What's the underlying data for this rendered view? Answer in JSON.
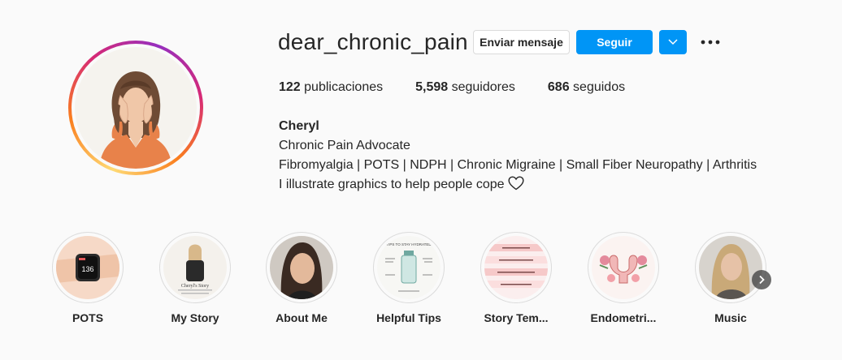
{
  "profile": {
    "username": "dear_chronic_pain",
    "buttons": {
      "message": "Enviar mensaje",
      "follow": "Seguir"
    },
    "stats": {
      "posts_count": "122",
      "posts_label": "publicaciones",
      "followers_count": "5,598",
      "followers_label": "seguidores",
      "following_count": "686",
      "following_label": "seguidos"
    },
    "bio": {
      "name": "Cheryl",
      "line1": "Chronic Pain Advocate",
      "line2": "Fibromyalgia | POTS | NDPH | Chronic Migraine | Small Fiber Neuropathy | Arthritis",
      "line3": "I illustrate graphics to help people cope"
    }
  },
  "highlights": [
    {
      "label": "POTS"
    },
    {
      "label": "My Story",
      "image_text": "Cheryl's Story"
    },
    {
      "label": "About Me"
    },
    {
      "label": "Helpful Tips",
      "image_text": "TIPS TO STAY HYDRATED"
    },
    {
      "label": "Story Tem..."
    },
    {
      "label": "Endometri..."
    },
    {
      "label": "Music"
    }
  ],
  "watch_reading": "136",
  "colors": {
    "accent": "#0095f6",
    "text": "#262626",
    "background": "#fafafa",
    "border": "#dbdbdb"
  },
  "icons": {
    "dropdown": "chevron-down-icon",
    "more": "more-options-icon",
    "heart": "heart-outline-icon",
    "next": "chevron-right-icon"
  }
}
